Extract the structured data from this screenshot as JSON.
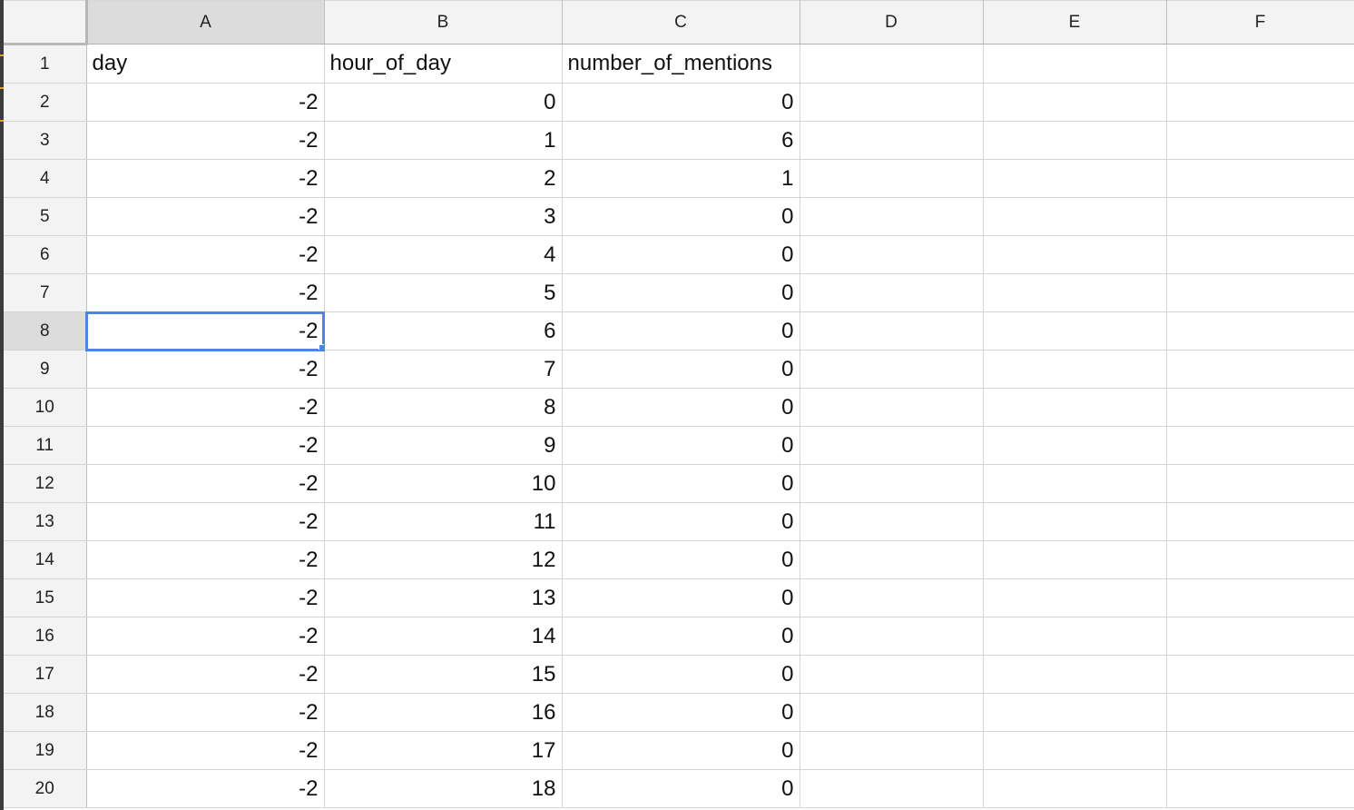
{
  "columns": [
    "A",
    "B",
    "C",
    "D",
    "E",
    "F"
  ],
  "row_numbers": [
    "1",
    "2",
    "3",
    "4",
    "5",
    "6",
    "7",
    "8",
    "9",
    "10",
    "11",
    "12",
    "13",
    "14",
    "15",
    "16",
    "17",
    "18",
    "19",
    "20"
  ],
  "header_row": [
    "day",
    "hour_of_day",
    "number_of_mentions"
  ],
  "data_rows": [
    [
      "-2",
      "0",
      "0"
    ],
    [
      "-2",
      "1",
      "6"
    ],
    [
      "-2",
      "2",
      "1"
    ],
    [
      "-2",
      "3",
      "0"
    ],
    [
      "-2",
      "4",
      "0"
    ],
    [
      "-2",
      "5",
      "0"
    ],
    [
      "-2",
      "6",
      "0"
    ],
    [
      "-2",
      "7",
      "0"
    ],
    [
      "-2",
      "8",
      "0"
    ],
    [
      "-2",
      "9",
      "0"
    ],
    [
      "-2",
      "10",
      "0"
    ],
    [
      "-2",
      "11",
      "0"
    ],
    [
      "-2",
      "12",
      "0"
    ],
    [
      "-2",
      "13",
      "0"
    ],
    [
      "-2",
      "14",
      "0"
    ],
    [
      "-2",
      "15",
      "0"
    ],
    [
      "-2",
      "16",
      "0"
    ],
    [
      "-2",
      "17",
      "0"
    ],
    [
      "-2",
      "18",
      "0"
    ]
  ],
  "selection": {
    "cell": "A8",
    "column": "A",
    "row": "8"
  },
  "colors": {
    "selection": "#4a86e8",
    "header_bg": "#f3f3f3",
    "active_header_bg": "#dcdcdc",
    "grid": "#d4d4d4"
  }
}
